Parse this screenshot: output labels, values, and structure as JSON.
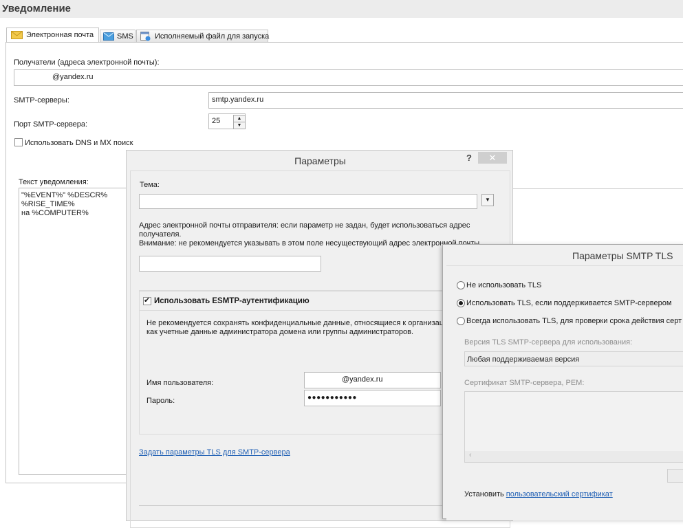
{
  "header": {
    "title": "Уведомление"
  },
  "tabs": [
    {
      "label": "Электронная почта",
      "icon": "envelope-icon"
    },
    {
      "label": "SMS",
      "icon": "sms-icon"
    },
    {
      "label": "Исполняемый файл для запуска",
      "icon": "executable-icon"
    }
  ],
  "email": {
    "recipients_label": "Получатели (адреса электронной почты):",
    "recipients_value": "@yandex.ru",
    "smtp_label": "SMTP-серверы:",
    "smtp_value": "smtp.yandex.ru",
    "port_label": "Порт SMTP-сервера:",
    "port_value": "25",
    "dns_label": "Использовать DNS и MX поиск",
    "notification_label": "Текст уведомления:",
    "notification_lines": [
      "\"%EVENT%\" %DESCR%",
      "%RISE_TIME%",
      "на %COMPUTER%"
    ]
  },
  "params_dialog": {
    "title": "Параметры",
    "help": "?",
    "close": "✕",
    "subject_label": "Тема:",
    "subject_value": "",
    "sender_note_1": "Адрес электронной почты отправителя: если параметр не задан, будет использоваться адрес",
    "sender_note_2": "получателя.",
    "sender_note_3": "Внимание: не рекомендуется указывать в этом поле несуществующий адрес электронной почты.",
    "sender_value": "",
    "esmtp_label": "Использовать ESMTP-аутентификацию",
    "esmtp_note_1": "Не рекомендуется сохранять конфиденциальные данные, относящиеся к организац",
    "esmtp_note_2": "как учетные данные администратора домена или группы администраторов.",
    "username_label": "Имя пользователя:",
    "username_value": "@yandex.ru",
    "password_label": "Пароль:",
    "password_value": "●●●●●●●●●●●",
    "tls_link": "Задать параметры TLS для SMTP-сервера"
  },
  "tls_dialog": {
    "title": "Параметры SMTP TLS",
    "radio_no_tls": "Не использовать TLS",
    "radio_tls_if_supported": "Использовать TLS, если поддерживается SMTP-сервером",
    "radio_always_tls": "Всегда использовать TLS, для проверки срока действия серт",
    "selected_option": "radio_tls_if_supported",
    "version_label": "Версия TLS SMTP-сервера для использования:",
    "version_value": "Любая поддерживаемая версия",
    "cert_label": "Сертификат SMTP-сервера, PEM:",
    "install_prefix": "Установить ",
    "install_link": "пользовательский сертификат"
  },
  "colors": {
    "link": "#1f5fb4",
    "header_bg": "#ececec",
    "dialog_bg": "#f0f0f0"
  }
}
